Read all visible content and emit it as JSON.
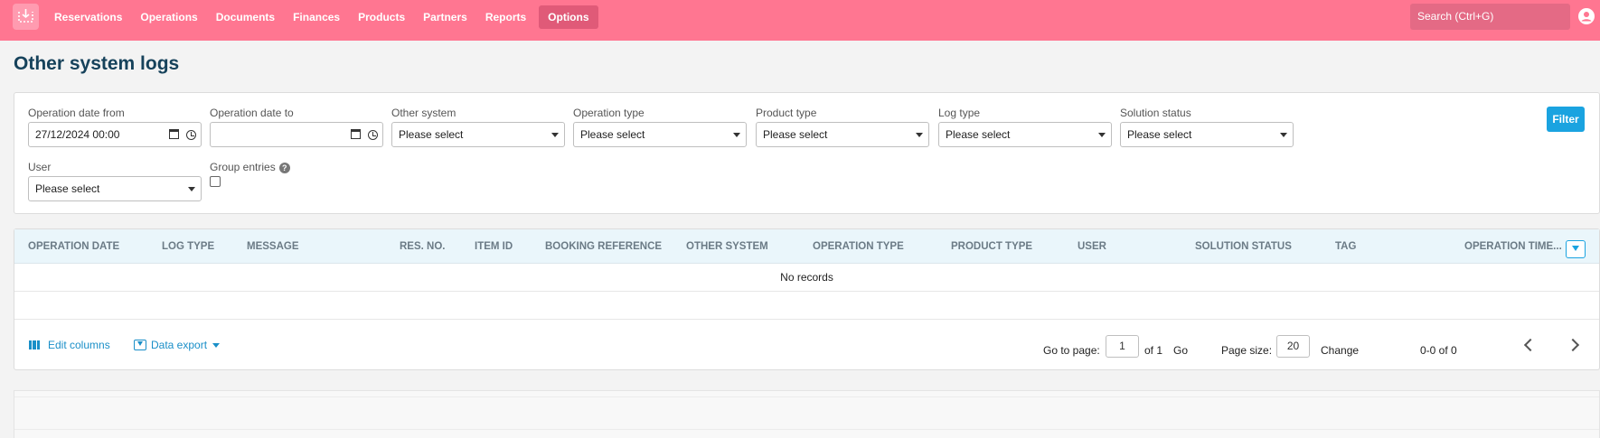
{
  "nav": {
    "items": [
      "Reservations",
      "Operations",
      "Documents",
      "Finances",
      "Products",
      "Partners",
      "Reports"
    ],
    "active": "Options",
    "search_placeholder": "Search (Ctrl+G)"
  },
  "page": {
    "title": "Other system logs"
  },
  "filters": {
    "date_from": {
      "label": "Operation date from",
      "value": "27/12/2024 00:00"
    },
    "date_to": {
      "label": "Operation date to",
      "value": ""
    },
    "other_system": {
      "label": "Other system",
      "value": "Please select"
    },
    "operation_type": {
      "label": "Operation type",
      "value": "Please select"
    },
    "product_type": {
      "label": "Product type",
      "value": "Please select"
    },
    "log_type": {
      "label": "Log type",
      "value": "Please select"
    },
    "solution_status": {
      "label": "Solution status",
      "value": "Please select"
    },
    "user": {
      "label": "User",
      "value": "Please select"
    },
    "group_entries": {
      "label": "Group entries",
      "help": "?",
      "checked": false
    },
    "filter_button": "Filter"
  },
  "grid": {
    "columns": [
      "Operation date",
      "Log type",
      "Message",
      "Res. no.",
      "Item ID",
      "Booking reference",
      "Other system",
      "Operation type",
      "Product type",
      "User",
      "Solution status",
      "Tag",
      "Operation time..."
    ],
    "empty_text": "No records",
    "footer": {
      "edit_columns": "Edit columns",
      "data_export": "Data export",
      "go_to_page_label": "Go to page:",
      "page_value": "1",
      "of_pages": "of 1",
      "go": "Go",
      "page_size_label": "Page size:",
      "page_size_value": "20",
      "change": "Change",
      "range": "0-0 of 0"
    }
  },
  "colors": {
    "nav_bg": "#ff7691",
    "accent": "#1aa3e0",
    "title": "#16425b"
  }
}
